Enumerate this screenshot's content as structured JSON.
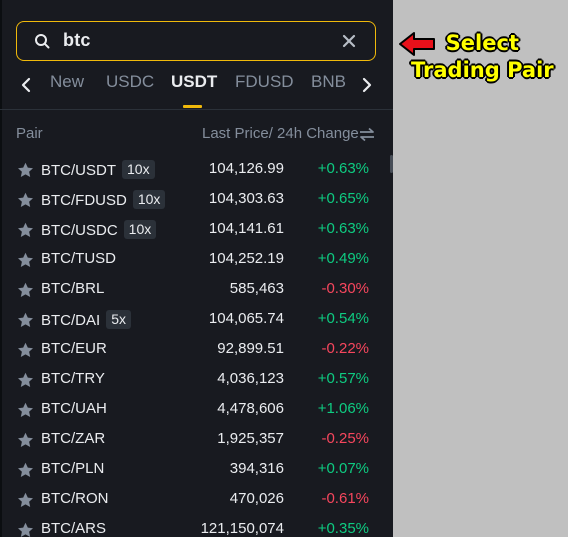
{
  "search": {
    "value": "btc"
  },
  "tabs": [
    {
      "label": "New",
      "active": false
    },
    {
      "label": "USDC",
      "active": false
    },
    {
      "label": "USDT",
      "active": true
    },
    {
      "label": "FDUSD",
      "active": false
    },
    {
      "label": "BNB",
      "active": false
    }
  ],
  "header": {
    "pair": "Pair",
    "price_change": "Last Price/ 24h Change"
  },
  "rows": [
    {
      "pair": "BTC/USDT",
      "lev": "10x",
      "price": "104,126.99",
      "change": "+0.63%",
      "dir": "up"
    },
    {
      "pair": "BTC/FDUSD",
      "lev": "10x",
      "price": "104,303.63",
      "change": "+0.65%",
      "dir": "up"
    },
    {
      "pair": "BTC/USDC",
      "lev": "10x",
      "price": "104,141.61",
      "change": "+0.63%",
      "dir": "up"
    },
    {
      "pair": "BTC/TUSD",
      "lev": "",
      "price": "104,252.19",
      "change": "+0.49%",
      "dir": "up"
    },
    {
      "pair": "BTC/BRL",
      "lev": "",
      "price": "585,463",
      "change": "-0.30%",
      "dir": "down"
    },
    {
      "pair": "BTC/DAI",
      "lev": "5x",
      "price": "104,065.74",
      "change": "+0.54%",
      "dir": "up"
    },
    {
      "pair": "BTC/EUR",
      "lev": "",
      "price": "92,899.51",
      "change": "-0.22%",
      "dir": "down"
    },
    {
      "pair": "BTC/TRY",
      "lev": "",
      "price": "4,036,123",
      "change": "+0.57%",
      "dir": "up"
    },
    {
      "pair": "BTC/UAH",
      "lev": "",
      "price": "4,478,606",
      "change": "+1.06%",
      "dir": "up"
    },
    {
      "pair": "BTC/ZAR",
      "lev": "",
      "price": "1,925,357",
      "change": "-0.25%",
      "dir": "down"
    },
    {
      "pair": "BTC/PLN",
      "lev": "",
      "price": "394,316",
      "change": "+0.07%",
      "dir": "up"
    },
    {
      "pair": "BTC/RON",
      "lev": "",
      "price": "470,026",
      "change": "-0.61%",
      "dir": "down"
    },
    {
      "pair": "BTC/ARS",
      "lev": "",
      "price": "121,150,074",
      "change": "+0.35%",
      "dir": "up"
    }
  ],
  "annotation": {
    "line1": "Select",
    "line2": "Trading Pair"
  },
  "colors": {
    "accent": "#f0b90b",
    "up": "#0ecb81",
    "down": "#f6465d",
    "panel_bg": "#181a20",
    "page_bg": "#c0c0c0"
  }
}
